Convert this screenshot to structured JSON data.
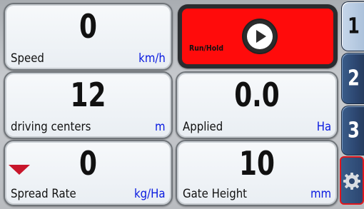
{
  "tiles": {
    "speed": {
      "value": "0",
      "label": "Speed",
      "unit": "km/h"
    },
    "driving": {
      "value": "12",
      "label": "driving centers",
      "unit": "m"
    },
    "applied": {
      "value": "0.0",
      "label": "Applied",
      "unit": "Ha"
    },
    "spread": {
      "value": "0",
      "label": "Spread Rate",
      "unit": "kg/Ha"
    },
    "gate": {
      "value": "10",
      "label": "Gate Height",
      "unit": "mm"
    }
  },
  "run_hold": {
    "label": "Run/Hold",
    "icon": "play-icon",
    "color": "#ff0b0b"
  },
  "tabs": [
    {
      "label": "1",
      "active": true
    },
    {
      "label": "2",
      "active": false
    },
    {
      "label": "3",
      "active": false
    }
  ],
  "settings": {
    "icon": "gear-icon",
    "border_color": "#e0161c"
  },
  "spread_indicator": {
    "icon": "triangle-down-icon",
    "color": "#c8162b"
  },
  "colors": {
    "unit_text": "#0a1be0",
    "accent_tab": "#2c4670"
  }
}
